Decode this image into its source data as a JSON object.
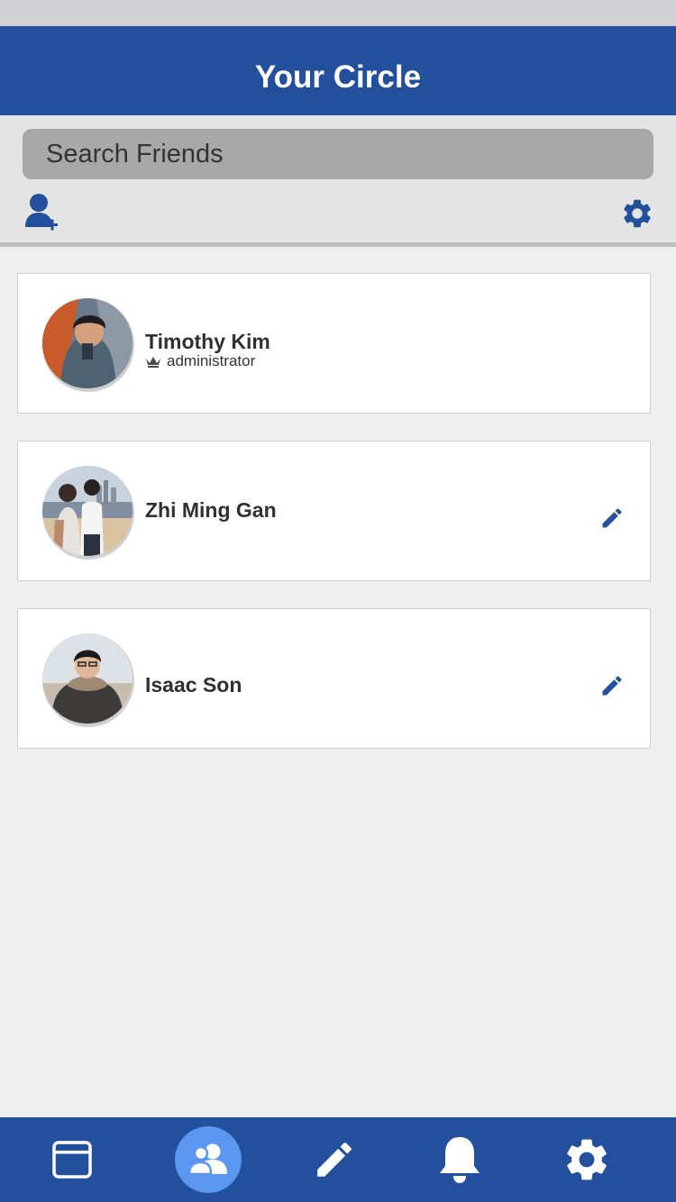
{
  "header": {
    "title": "Your Circle"
  },
  "search": {
    "placeholder": "Search Friends",
    "value": ""
  },
  "toolbar": {
    "add_friend_icon": "add-user-icon",
    "settings_icon": "gear-icon"
  },
  "friends": [
    {
      "name": "Timothy Kim",
      "role": "administrator",
      "role_icon": "crown-icon",
      "editable": false
    },
    {
      "name": "Zhi Ming Gan",
      "role": "",
      "editable": true,
      "edit_icon": "pencil-icon"
    },
    {
      "name": "Isaac Son",
      "role": "",
      "editable": true,
      "edit_icon": "pencil-icon"
    }
  ],
  "bottom_nav": {
    "items": [
      {
        "icon": "window-icon",
        "active": false
      },
      {
        "icon": "friends-icon",
        "active": true
      },
      {
        "icon": "pencil-icon",
        "active": false
      },
      {
        "icon": "bell-icon",
        "active": false
      },
      {
        "icon": "gear-icon",
        "active": false
      }
    ]
  },
  "colors": {
    "brand": "#23509c",
    "active_nav": "#5b96f0",
    "background": "#efefef"
  }
}
